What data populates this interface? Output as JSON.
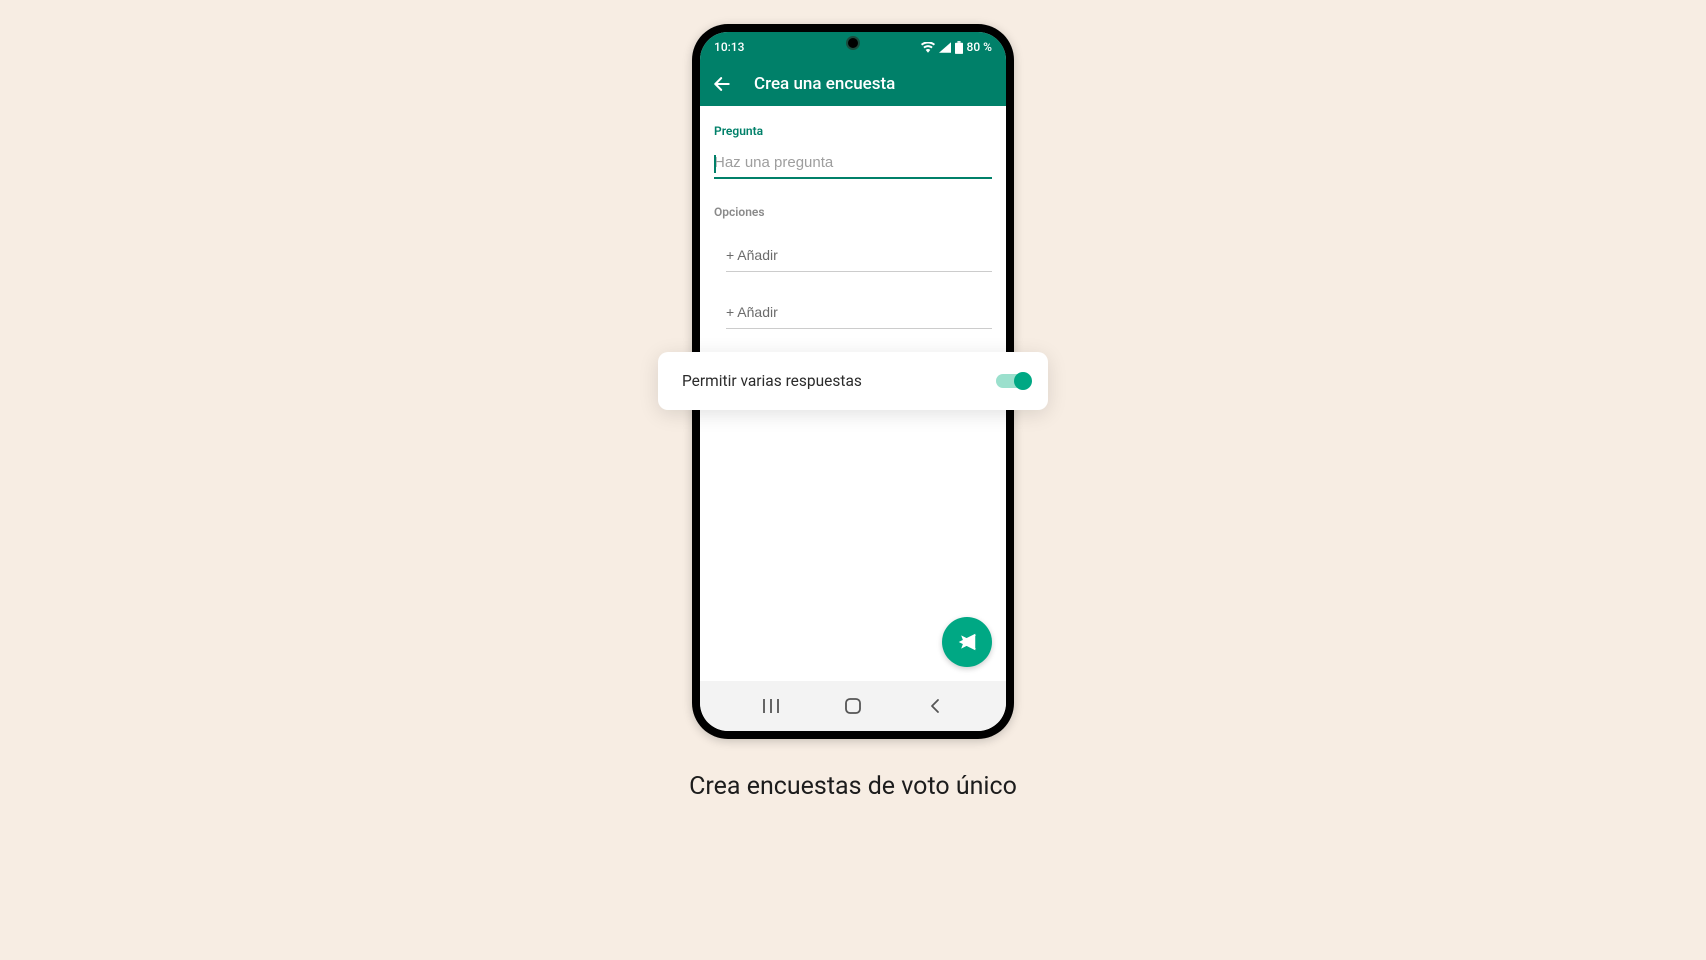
{
  "status": {
    "time": "10:13",
    "battery": "80 %"
  },
  "appbar": {
    "title": "Crea una encuesta"
  },
  "form": {
    "question_label": "Pregunta",
    "question_placeholder": "Haz una pregunta",
    "question_value": "",
    "options_label": "Opciones",
    "option_placeholder": "+ Añadir"
  },
  "toggle": {
    "label": "Permitir varias respuestas",
    "on": true
  },
  "caption": "Crea encuestas de voto único"
}
